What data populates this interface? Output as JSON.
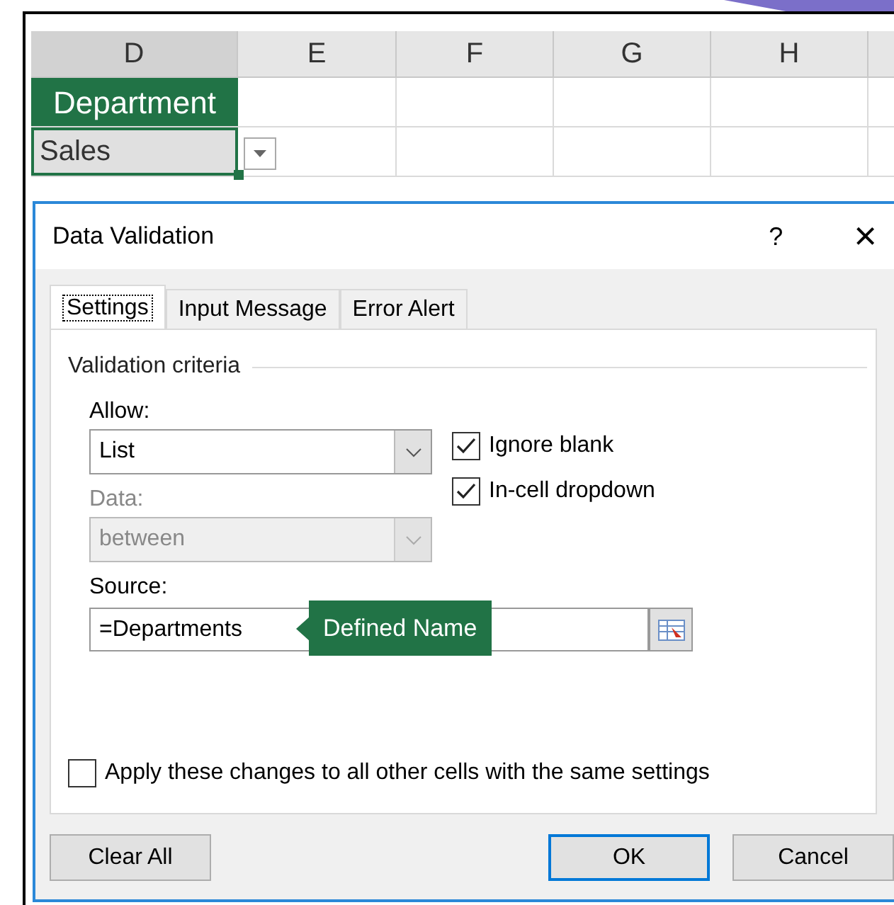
{
  "sheet": {
    "columns": [
      {
        "label": "D",
        "selected": true
      },
      {
        "label": "E",
        "selected": false
      },
      {
        "label": "F",
        "selected": false
      },
      {
        "label": "G",
        "selected": false
      },
      {
        "label": "H",
        "selected": false
      }
    ],
    "header_cell": "Department",
    "active_cell": "Sales"
  },
  "dialog": {
    "title": "Data Validation",
    "help": "?",
    "close": "×",
    "tabs": [
      {
        "label": "Settings",
        "selected": true
      },
      {
        "label": "Input Message",
        "selected": false
      },
      {
        "label": "Error Alert",
        "selected": false
      }
    ],
    "group_title": "Validation criteria",
    "allow": {
      "label": "Allow:",
      "value": "List",
      "disabled": false
    },
    "data": {
      "label": "Data:",
      "value": "between",
      "disabled": true
    },
    "checkboxes": [
      {
        "label": "Ignore blank",
        "checked": true
      },
      {
        "label": "In-cell dropdown",
        "checked": true
      }
    ],
    "source": {
      "label": "Source:",
      "value": "=Departments"
    },
    "callout": "Defined Name",
    "apply_all": {
      "label": "Apply these changes to all other cells with the same settings",
      "checked": false
    },
    "buttons": [
      {
        "label": "Clear All",
        "default": false
      },
      {
        "label": "OK",
        "default": true
      },
      {
        "label": "Cancel",
        "default": false
      }
    ]
  }
}
